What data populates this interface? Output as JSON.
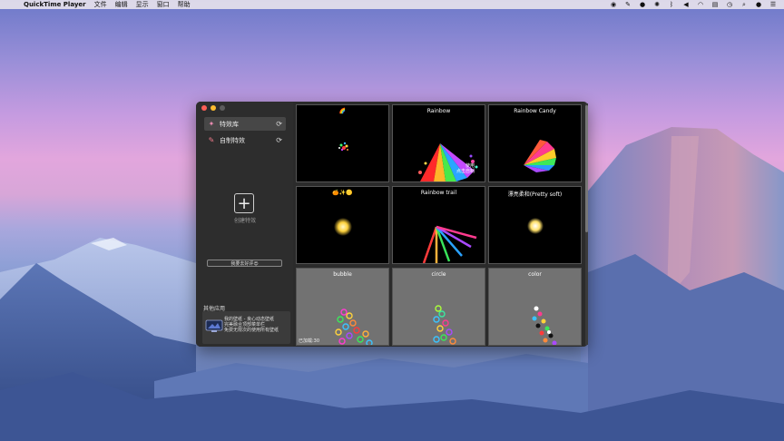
{
  "menubar": {
    "app_name": "QuickTime Player",
    "menus": [
      "文件",
      "编辑",
      "显示",
      "窗口",
      "帮助"
    ],
    "status_icons": [
      "record-icon",
      "tool-icon",
      "wechat-icon",
      "brightness-icon",
      "bluetooth-icon",
      "volume-icon",
      "wifi-icon",
      "flag-icon",
      "clock-icon",
      "search-icon",
      "user-icon",
      "list-icon"
    ]
  },
  "sidebar": {
    "items": [
      {
        "label": "特效库",
        "icon": "wand-icon",
        "active": true
      },
      {
        "label": "自制特效",
        "icon": "brush-icon",
        "active": false
      }
    ],
    "create_label": "创建特效",
    "review_label": "我要去好评😍",
    "other_apps_title": "其他应用",
    "ad_lines": [
      "我的壁纸 - 良心动态壁纸",
      "完美融合顶部菜单栏",
      "免费无限次的使用所有壁纸"
    ]
  },
  "grid": {
    "cells": [
      {
        "title": "🌈",
        "bg": "#000000",
        "effect": "small-burst"
      },
      {
        "title": "Rainbow",
        "bg": "#000000",
        "effect": "rainbow-spray"
      },
      {
        "title": "Rainbow Candy",
        "bg": "#000000",
        "effect": "rainbow-fan"
      },
      {
        "title": "🍊✨🟡",
        "bg": "#000000",
        "effect": "glow-dot"
      },
      {
        "title": "Rainbow trail",
        "bg": "#000000",
        "effect": "rainbow-rays"
      },
      {
        "title": "漂亮柔和(Pretty soft)",
        "bg": "#000000",
        "effect": "soft-dot"
      },
      {
        "title": "bubble",
        "bg": "#727272",
        "effect": "bubbles"
      },
      {
        "title": "circle",
        "bg": "#727272",
        "effect": "circles"
      },
      {
        "title": "color",
        "bg": "#727272",
        "effect": "color-dots"
      }
    ],
    "overlay_text": [
      "使用",
      "点击自制"
    ],
    "loaded_label": "已加载:30"
  }
}
